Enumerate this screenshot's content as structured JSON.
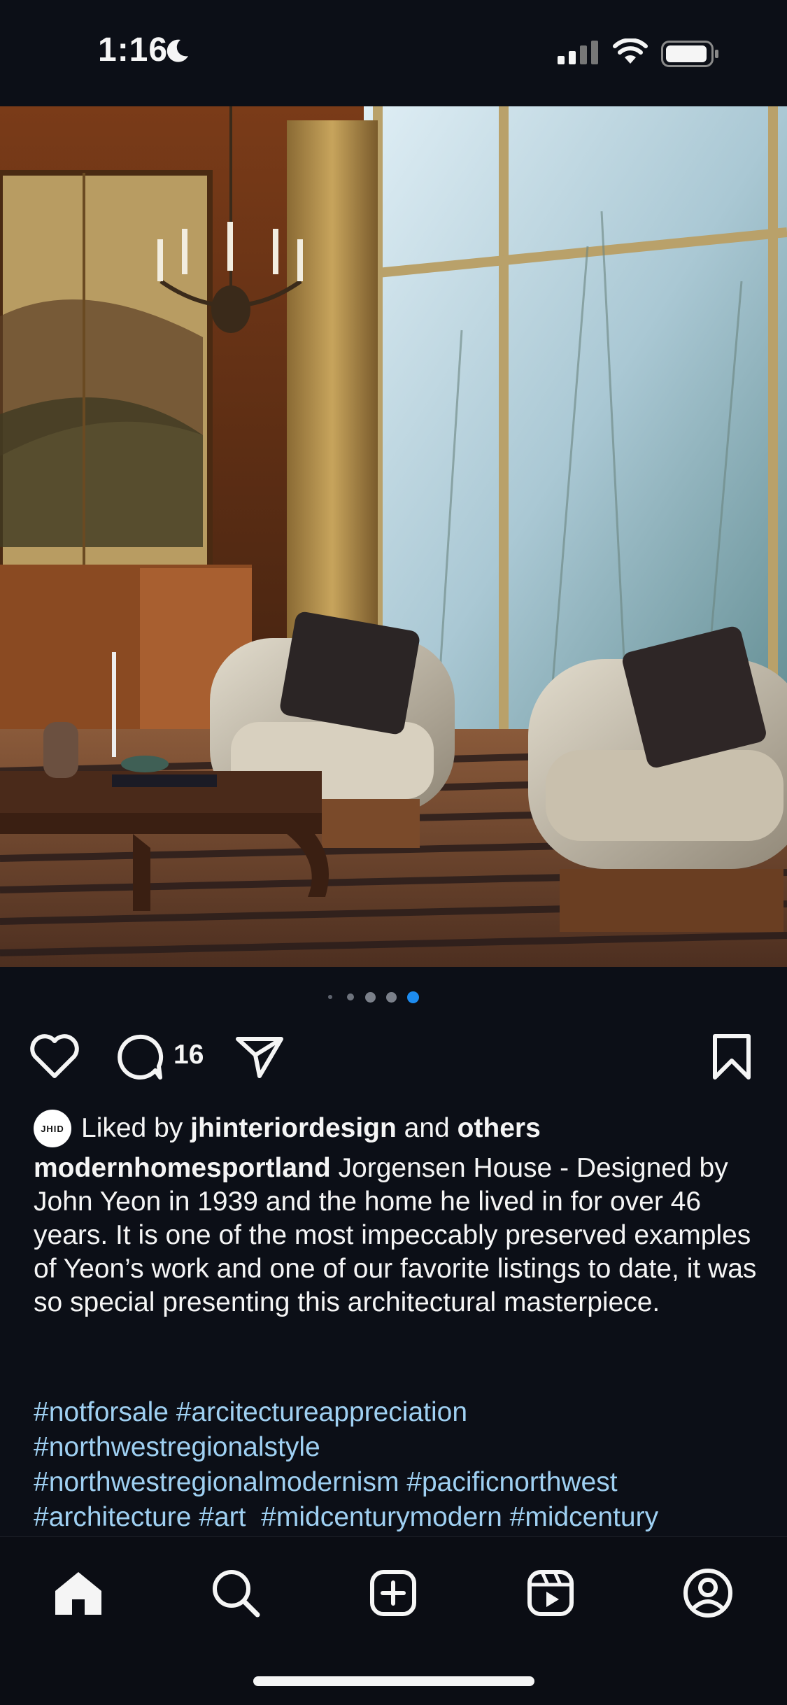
{
  "status_bar": {
    "time": "1:16",
    "icons": [
      "moon-icon",
      "signal-icon",
      "wifi-icon",
      "battery-icon"
    ]
  },
  "post": {
    "image_alt": "Living room with armchairs, coffee table, folding screen and tall windows",
    "carousel": {
      "total": 5,
      "active_index": 4
    },
    "comment_count": "16",
    "liked_by": {
      "prefix": "Liked by ",
      "user": "jhinteriordesign",
      "middle": " and ",
      "suffix": "others",
      "avatar_text": "JHID"
    },
    "caption": {
      "username": "modernhomesportland",
      "text": " Jorgensen House - Designed by John Yeon in 1939 and the home he lived in for over 46 years. It is one of the most impeccably preserved examples of Yeon’s work and one of our favorite listings to date, it was so special presenting this architectural masterpiece."
    },
    "hashtags": [
      "#notforsale #arcitectureappreciation",
      "#northwestregionalstyle",
      "#northwestregionalmodernism #pacificnorthwest",
      "#architecture #art  #midcenturymodern #midcentury"
    ]
  },
  "tab_bar": {
    "items": [
      "home",
      "search",
      "create",
      "reels",
      "profile"
    ],
    "active": "home"
  },
  "colors": {
    "background": "#0c0f17",
    "hashtag": "#9fd0f2",
    "active_dot": "#1d8cf0"
  }
}
